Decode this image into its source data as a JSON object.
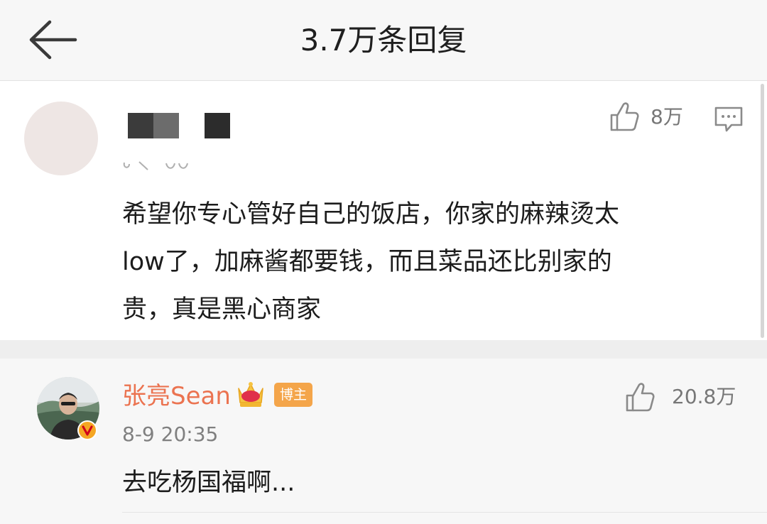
{
  "header": {
    "title": "3.7万条回复",
    "back_icon": "arrow-left-icon"
  },
  "main_comment": {
    "like_count": "8万",
    "content_lines": [
      "希望你专心管好自己的饭店，你家的麻辣烫太",
      "low了，加麻酱都要钱，而且菜品还比别家的",
      "贵，真是黑心商家"
    ]
  },
  "reply": {
    "username": "张亮Sean",
    "badge": "博主",
    "timestamp": "8-9 20:35",
    "like_count": "20.8万",
    "text": "去吃杨国福啊..."
  },
  "colors": {
    "username": "#eb7350",
    "badge_bg": "#f4a54a",
    "verified": "#f5a623",
    "meta_text": "#808080"
  }
}
